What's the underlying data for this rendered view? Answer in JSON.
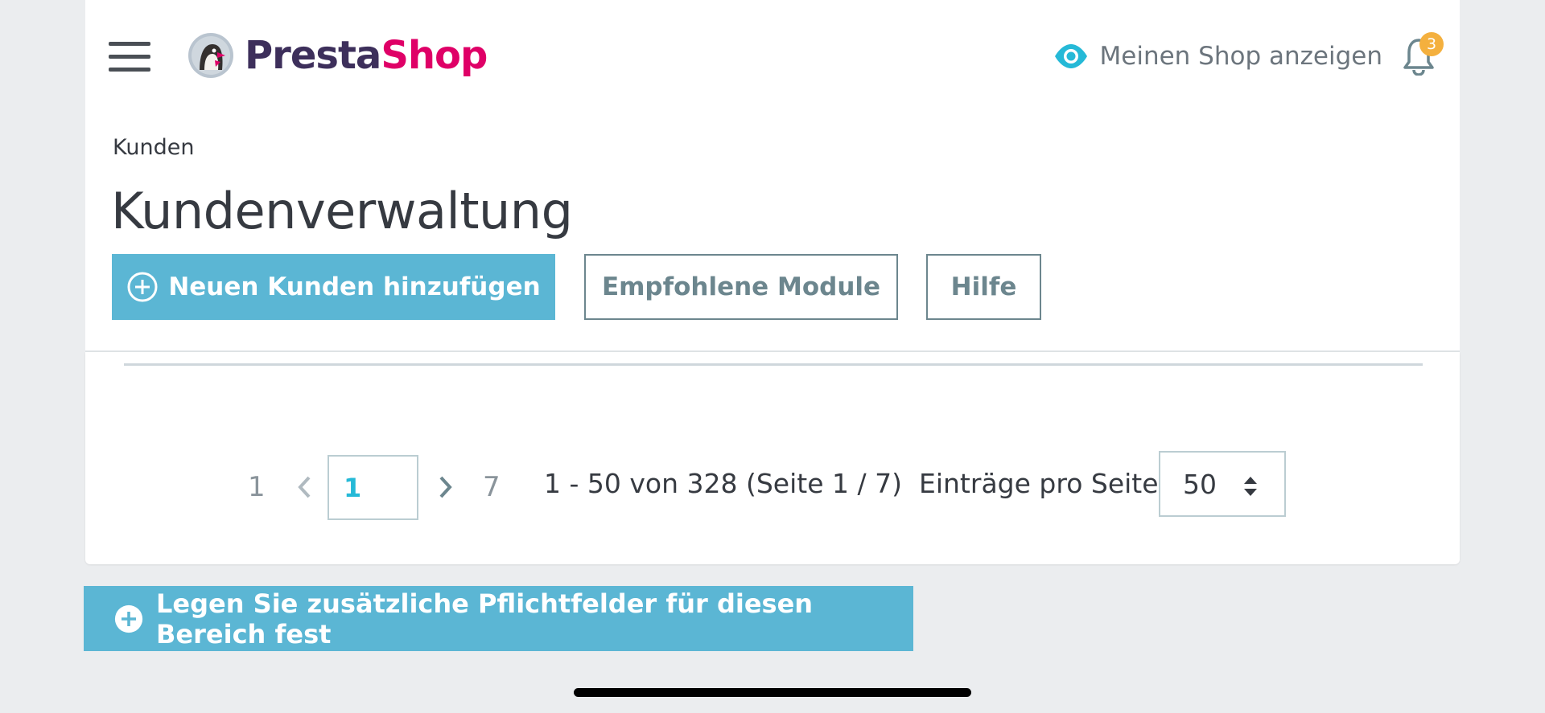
{
  "header": {
    "logo_text_part1": "Presta",
    "logo_text_part2": "Shop",
    "view_shop_label": "Meinen Shop anzeigen",
    "notification_count": "3"
  },
  "breadcrumb": "Kunden",
  "page_title": "Kundenverwaltung",
  "toolbar": {
    "add_customer_label": "Neuen Kunden hinzufügen",
    "recommended_modules_label": "Empfohlene Module",
    "help_label": "Hilfe"
  },
  "pagination": {
    "first_page": "1",
    "current_page": "1",
    "last_page": "7",
    "info": "1 - 50 von 328 (Seite 1 / 7)",
    "per_page_label": "Einträge pro Seite",
    "per_page_value": "50"
  },
  "required_fields_label": "Legen Sie zusätzliche Pflichtfelder für diesen Bereich fest",
  "colors": {
    "primary": "#5bb6d4",
    "accent_link": "#25b9d7",
    "badge": "#f4b03e",
    "brand_purple": "#3d2f5b",
    "brand_pink": "#df0067"
  },
  "icons": {
    "menu": "hamburger-icon",
    "view": "eye-icon",
    "notifications": "bell-icon",
    "add": "plus-circle-icon",
    "prev": "chevron-left-icon",
    "next": "chevron-right-icon",
    "sort": "sort-arrows-icon"
  }
}
